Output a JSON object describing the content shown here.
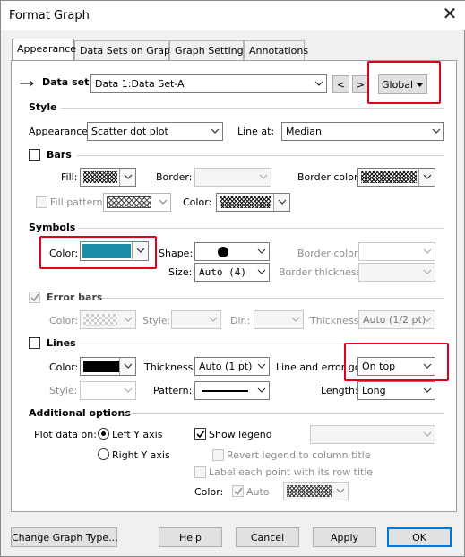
{
  "window": {
    "title": "Format Graph",
    "close_glyph": "✕"
  },
  "tabs": [
    {
      "label": "Appearance",
      "active": true
    },
    {
      "label": "Data Sets on Graph",
      "active": false
    },
    {
      "label": "Graph Settings",
      "active": false
    },
    {
      "label": "Annotations",
      "active": false
    }
  ],
  "dataset": {
    "label": "Data set:",
    "value": "Data 1:Data Set-A",
    "prev_glyph": "<",
    "next_glyph": ">",
    "scope_value": "Global"
  },
  "style": {
    "heading": "Style",
    "appearance_label": "Appearance:",
    "appearance_value": "Scatter dot plot",
    "line_at_label": "Line at:",
    "line_at_value": "Median"
  },
  "bars": {
    "heading": "Bars",
    "checked": false,
    "fill_label": "Fill:",
    "border_label": "Border:",
    "border_color_label": "Border color:",
    "fill_pattern_label": "Fill pattern",
    "color_label": "Color:"
  },
  "symbols": {
    "heading": "Symbols",
    "color_label": "Color:",
    "color_hex": "#1a8ea8",
    "shape_label": "Shape:",
    "size_label": "Size:",
    "size_value": "Auto (4)",
    "border_color_label": "Border color:",
    "border_thickness_label": "Border thickness:"
  },
  "error_bars": {
    "heading": "Error bars",
    "checked": true,
    "color_label": "Color:",
    "style_label": "Style:",
    "dir_label": "Dir.:",
    "thickness_label": "Thickness:",
    "thickness_value": "Auto (1/2 pt)"
  },
  "lines": {
    "heading": "Lines",
    "checked": false,
    "color_label": "Color:",
    "thickness_label": "Thickness:",
    "thickness_value": "Auto (1 pt)",
    "line_and_error_label": "Line and error go:",
    "line_and_error_value": "On top",
    "style_label": "Style:",
    "pattern_label": "Pattern:",
    "length_label": "Length:",
    "length_value": "Long"
  },
  "additional": {
    "heading": "Additional options",
    "plot_data_on_label": "Plot data on:",
    "left_axis_label": "Left Y axis",
    "right_axis_label": "Right  Y axis",
    "show_legend_label": "Show legend",
    "show_legend_checked": true,
    "revert_legend_label": "Revert legend to column title",
    "label_each_point_label": "Label each point with its row title",
    "color_label": "Color:",
    "auto_label": "Auto"
  },
  "footer": {
    "change_graph_type": "Change Graph Type...",
    "help": "Help",
    "cancel": "Cancel",
    "apply": "Apply",
    "ok": "OK"
  },
  "colors": {
    "highlight_box": "#e0001a",
    "symbol_color": "#1a8ea8",
    "accent": "#0078d7"
  },
  "icons": [
    "close-icon",
    "chevron-down-icon",
    "checkmark-icon",
    "triangle-down-icon"
  ]
}
